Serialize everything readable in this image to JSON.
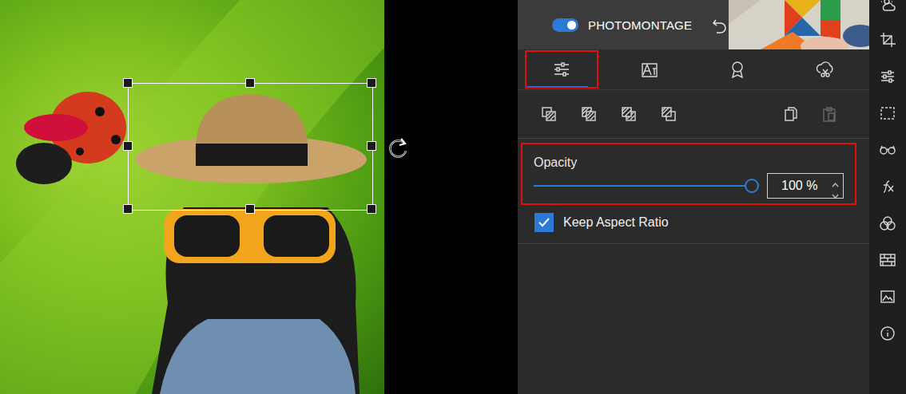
{
  "canvas": {
    "selection": {
      "selected": true
    }
  },
  "mode": {
    "label": "PHOTOMONTAGE",
    "on": true
  },
  "tabs": [
    {
      "selected": true,
      "highlighted": true
    },
    {
      "selected": false,
      "highlighted": false
    },
    {
      "selected": false,
      "highlighted": false
    },
    {
      "selected": false,
      "highlighted": false
    }
  ],
  "actions": {
    "copy": {
      "disabled": false
    },
    "paste": {
      "disabled": true
    }
  },
  "opacity": {
    "label": "Opacity",
    "level": 1.0,
    "value": "100 %",
    "highlighted": true
  },
  "keep_aspect_ratio": {
    "label": "Keep Aspect Ratio",
    "checked": true
  }
}
